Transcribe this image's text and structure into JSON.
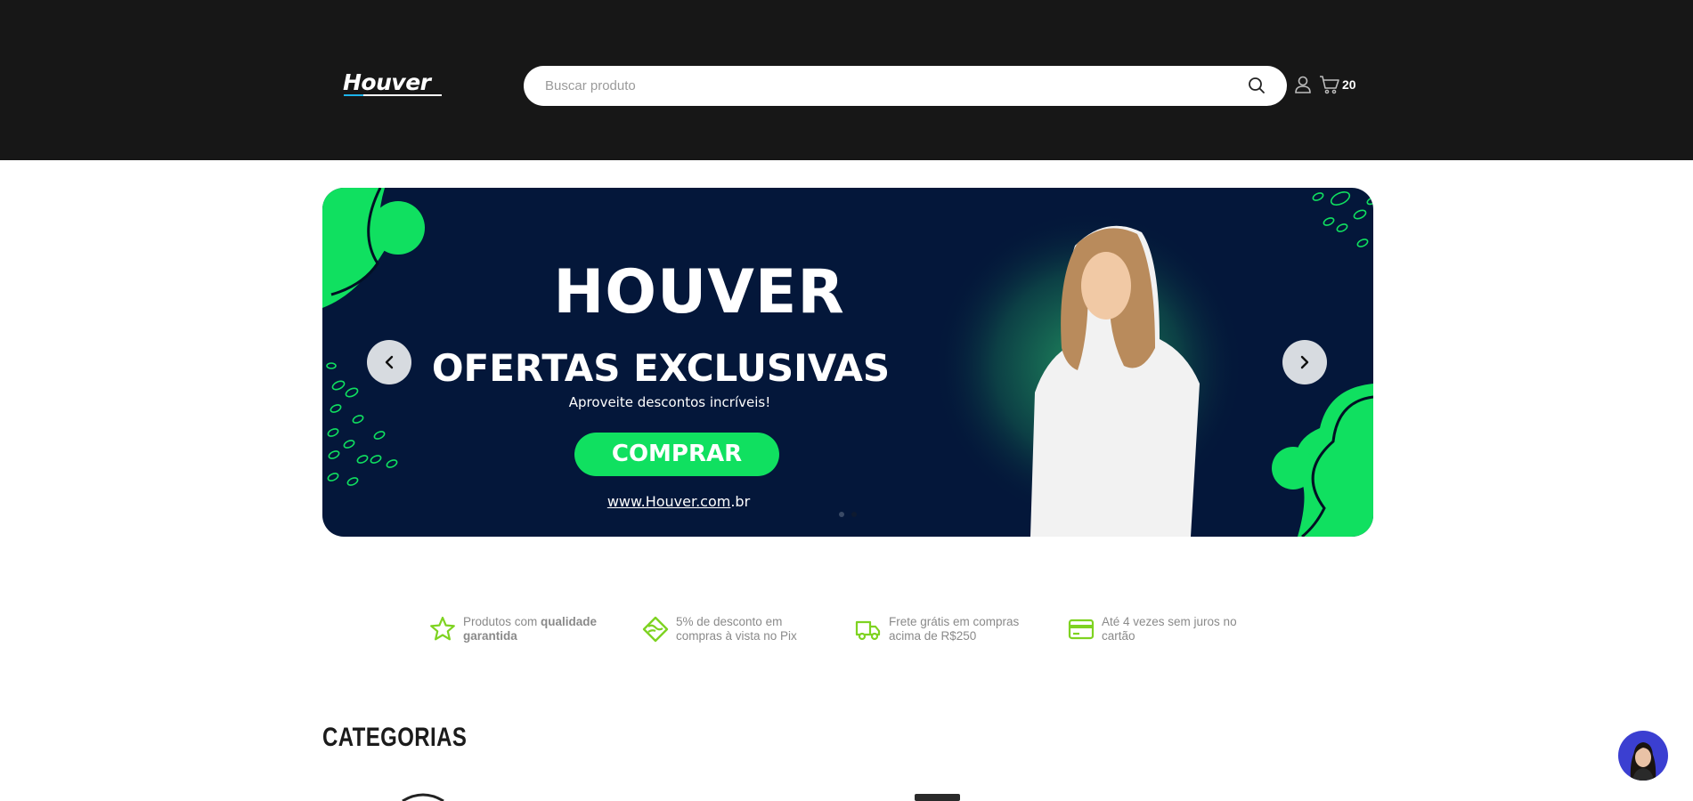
{
  "header": {
    "logo_text": "Houver",
    "search_placeholder": "Buscar produto",
    "cart_count": "20"
  },
  "banner": {
    "title": "HOUVER",
    "subtitle": "OFERTAS EXCLUSIVAS",
    "tagline": "Aproveite descontos incríveis!",
    "cta": "COMPRAR",
    "url_underlined": "www.Houver.com",
    "url_rest": ".br",
    "slide_count": 2,
    "active_slide": 2
  },
  "features": [
    {
      "text": "Produtos com ",
      "bold": "qualidade garantida",
      "icon": "star-icon"
    },
    {
      "text": "5% de desconto em compras à vista no Pix",
      "icon": "pix-icon"
    },
    {
      "text": "Frete grátis em compras acima de R$250",
      "icon": "truck-icon"
    },
    {
      "text": "Até 4 vezes sem juros no cartão",
      "icon": "credit-card-icon"
    }
  ],
  "categories_title": "CATEGORIAS",
  "colors": {
    "header_bg": "#171717",
    "accent_green": "#10e060",
    "feature_green": "#7ed321",
    "banner_bg": "#04173a",
    "chat_bg": "#3b3fd1"
  }
}
